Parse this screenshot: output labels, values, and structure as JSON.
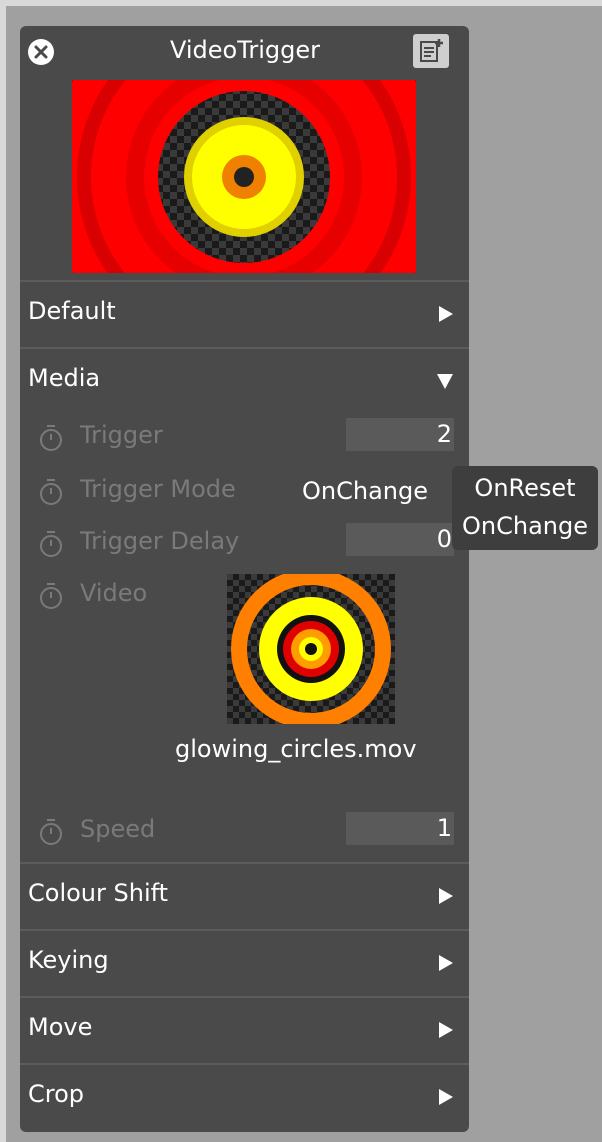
{
  "window": {
    "title": "VideoTrigger",
    "close_icon": "close-icon",
    "notes_icon": "add-note-icon"
  },
  "sections": [
    {
      "label": "Default",
      "state": "collapsed"
    },
    {
      "label": "Media",
      "state": "expanded"
    },
    {
      "label": "Colour Shift",
      "state": "collapsed"
    },
    {
      "label": "Keying",
      "state": "collapsed"
    },
    {
      "label": "Move",
      "state": "collapsed"
    },
    {
      "label": "Crop",
      "state": "collapsed"
    }
  ],
  "media": {
    "trigger": {
      "label": "Trigger",
      "value": "2"
    },
    "trigger_mode": {
      "label": "Trigger Mode",
      "value": "OnChange"
    },
    "trigger_delay": {
      "label": "Trigger Delay",
      "value": "0"
    },
    "video": {
      "label": "Video",
      "file": "glowing_circles.mov"
    },
    "speed": {
      "label": "Speed",
      "value": "1"
    }
  },
  "dropdown": {
    "options": [
      "OnReset",
      "OnChange"
    ]
  },
  "colors": {
    "panel_bg": "#4a4a4a",
    "background": "#a0a0a0",
    "text": "#ffffff",
    "muted_text": "#7a7a7a",
    "field_bg": "#5a5a5a"
  }
}
